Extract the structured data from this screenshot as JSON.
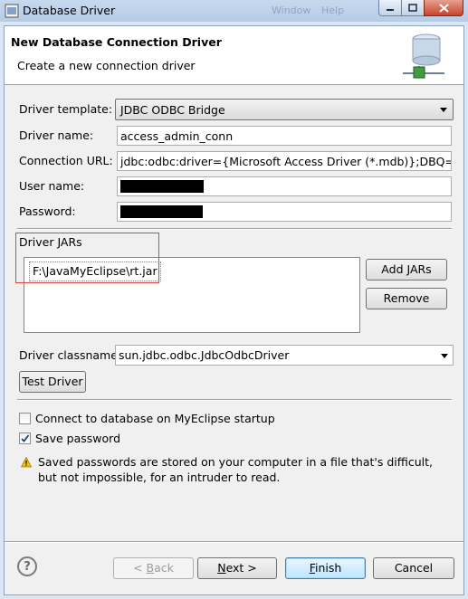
{
  "window": {
    "title": "Database Driver",
    "background_hint": [
      "Window",
      "Help"
    ]
  },
  "header": {
    "title": "New Database Connection Driver",
    "subtitle": "Create a new connection driver"
  },
  "form": {
    "driver_template": {
      "label": "Driver template:",
      "value": "JDBC ODBC Bridge"
    },
    "driver_name": {
      "label": "Driver name:",
      "value": "access_admin_conn"
    },
    "connection_url": {
      "label": "Connection URL:",
      "value": "jdbc:odbc:driver={Microsoft Access Driver (*.mdb)};DBQ=C:/tes"
    },
    "user_name": {
      "label": "User name:",
      "value": ""
    },
    "password": {
      "label": "Password:",
      "value": ""
    }
  },
  "jars": {
    "label": "Driver JARs",
    "items": [
      "F:\\JavaMyEclipse\\rt.jar"
    ],
    "add_button": "Add JARs",
    "remove_button": "Remove"
  },
  "classname": {
    "label": "Driver classname:",
    "value": "sun.jdbc.odbc.JdbcOdbcDriver"
  },
  "test_driver_button": "Test Driver",
  "options": {
    "connect_on_startup": {
      "label": "Connect to database on MyEclipse startup",
      "checked": false
    },
    "save_password": {
      "label": "Save password",
      "checked": true
    }
  },
  "warning": "Saved passwords are stored on your computer in a file that's difficult, but not impossible, for an intruder to read.",
  "footer": {
    "help": "?",
    "back": {
      "prefix": "< ",
      "mnemonic": "B",
      "rest": "ack"
    },
    "next": {
      "mnemonic": "N",
      "rest": "ext >"
    },
    "finish": {
      "mnemonic": "F",
      "rest": "inish"
    },
    "cancel": "Cancel"
  },
  "colors": {
    "title_bar": "#c7d9ee",
    "dialog": "#f0f0f0",
    "highlight": "#e0453f",
    "warning": "#f5c400"
  }
}
